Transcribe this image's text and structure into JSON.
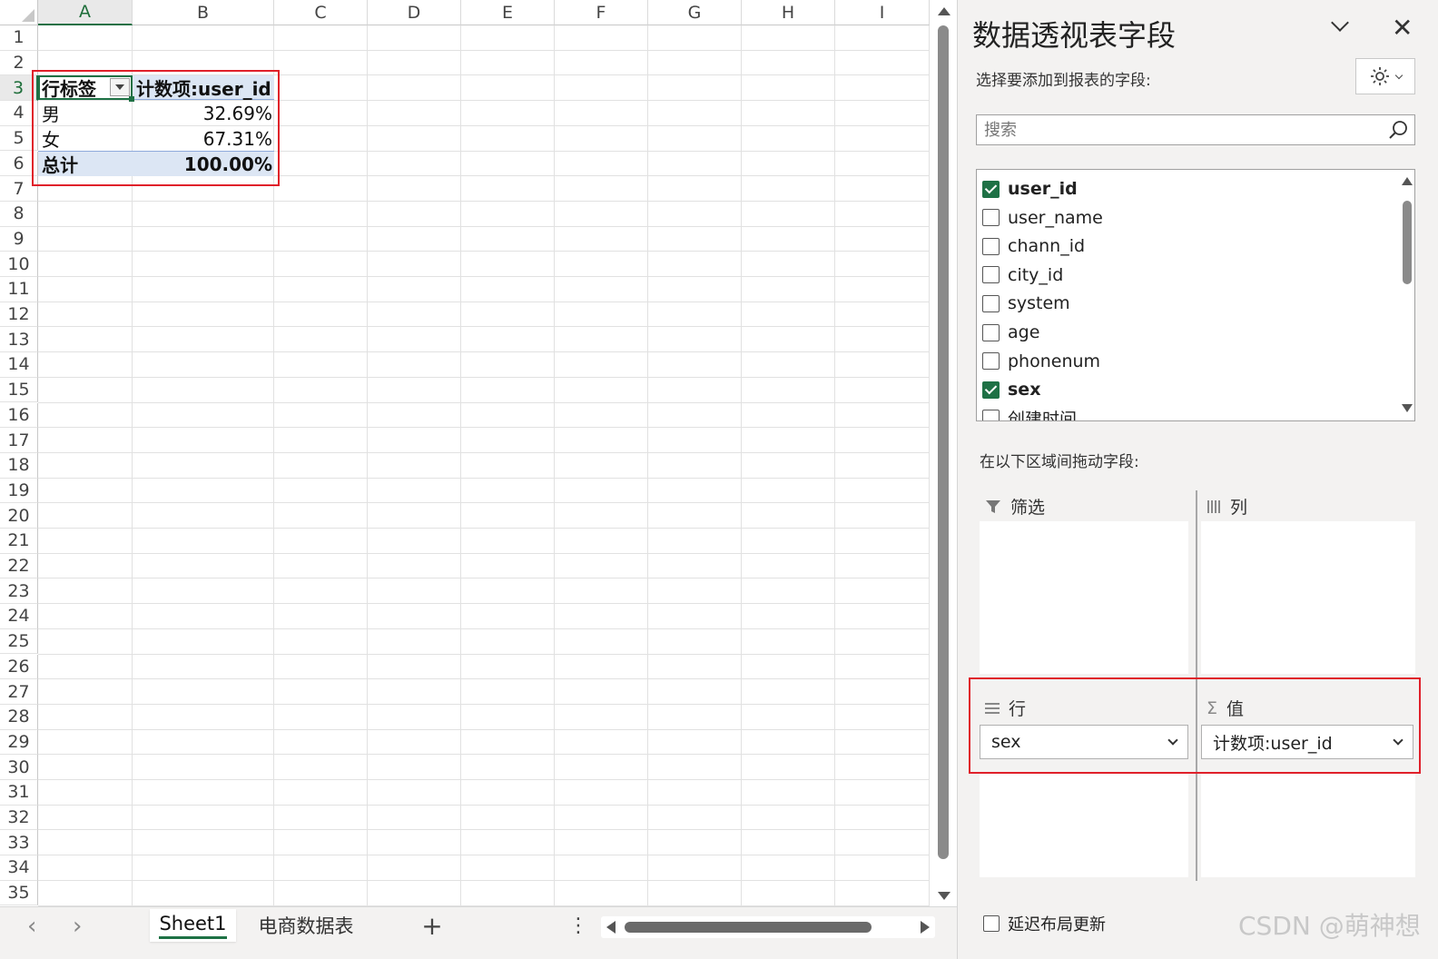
{
  "sheet": {
    "columns": [
      "A",
      "B",
      "C",
      "D",
      "E",
      "F",
      "G",
      "H",
      "I"
    ],
    "rows": [
      "1",
      "2",
      "3",
      "4",
      "5",
      "6",
      "7",
      "8",
      "9",
      "10",
      "11",
      "12",
      "13",
      "14",
      "15",
      "16",
      "17",
      "18",
      "19",
      "20",
      "21",
      "22",
      "23",
      "24",
      "25",
      "26",
      "27",
      "28",
      "29",
      "30",
      "31",
      "32",
      "33",
      "34",
      "35"
    ],
    "pivot": {
      "header_row_label": "行标签",
      "header_value_label": "计数项:user_id",
      "rows": [
        {
          "label": "男",
          "value": "32.69%"
        },
        {
          "label": "女",
          "value": "67.31%"
        }
      ],
      "total_label": "总计",
      "total_value": "100.00%"
    }
  },
  "tabs": {
    "items": [
      "Sheet1",
      "电商数据表"
    ],
    "active": "Sheet1",
    "add_label": "+",
    "more_label": "⋮"
  },
  "panel": {
    "title": "数据透视表字段",
    "choose_label": "选择要添加到报表的字段:",
    "search_placeholder": "搜索",
    "fields": [
      {
        "name": "user_id",
        "checked": true
      },
      {
        "name": "user_name",
        "checked": false
      },
      {
        "name": "chann_id",
        "checked": false
      },
      {
        "name": "city_id",
        "checked": false
      },
      {
        "name": "system",
        "checked": false
      },
      {
        "name": "age",
        "checked": false
      },
      {
        "name": "phonenum",
        "checked": false
      },
      {
        "name": "sex",
        "checked": true
      },
      {
        "name": "创建时间",
        "checked": false
      }
    ],
    "drag_label": "在以下区域间拖动字段:",
    "areas": {
      "filter": "筛选",
      "columns": "列",
      "rows": "行",
      "values": "值"
    },
    "row_field": "sex",
    "value_field": "计数项:user_id",
    "defer_label": "延迟布局更新"
  },
  "watermark": "CSDN @萌神想",
  "colors": {
    "accent_green": "#1e7145",
    "highlight_red": "#e0202a",
    "pivot_header_blue": "#dce6f4"
  }
}
